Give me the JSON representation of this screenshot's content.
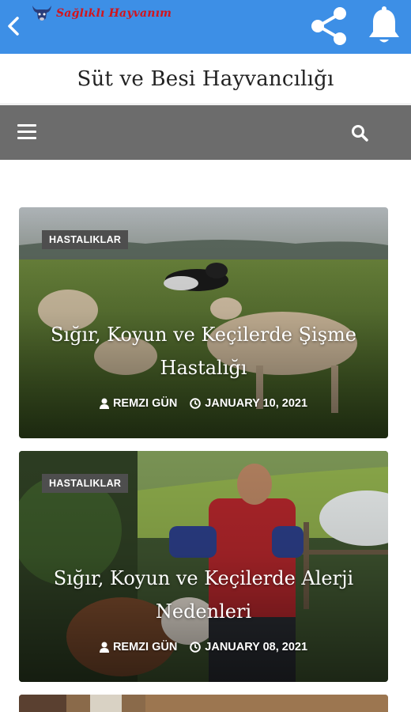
{
  "appbar": {
    "logo_text": "Sağlıklı Hayvanım",
    "back_icon": "chevron-left-icon",
    "share_icon": "share-icon",
    "bell_icon": "bell-icon",
    "color": "#3d8fe6"
  },
  "site": {
    "title": "Süt ve Besi Hayvancılığı"
  },
  "nav": {
    "menu_icon": "hamburger-menu-icon",
    "search_icon": "search-icon",
    "color": "#6c6c6c"
  },
  "posts": [
    {
      "category": "HASTALIKLAR",
      "title": "Sığır, Koyun ve Keçilerde Şişme Hastalığı",
      "author": "REMZI GÜN",
      "date": "JANUARY 10, 2021"
    },
    {
      "category": "HASTALIKLAR",
      "title": "Sığır, Koyun ve Keçilerde Alerji Nedenleri",
      "author": "REMZI GÜN",
      "date": "JANUARY 08, 2021"
    }
  ]
}
